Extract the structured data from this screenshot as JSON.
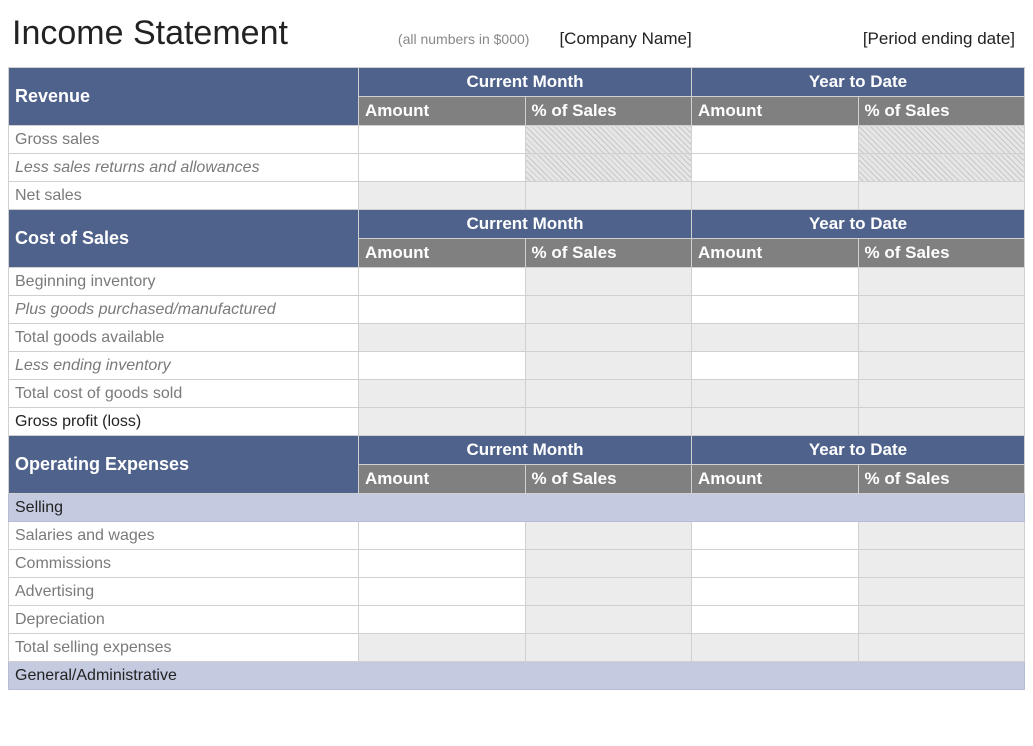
{
  "header": {
    "title": "Income Statement",
    "subtitle": "(all numbers in $000)",
    "company": "[Company Name]",
    "period": "[Period ending date]"
  },
  "columns": {
    "group1": "Current Month",
    "group2": "Year to Date",
    "sub1": "Amount",
    "sub2": "% of Sales"
  },
  "sections": {
    "revenue": {
      "title": "Revenue",
      "rows": {
        "gross_sales": "Gross sales",
        "less_returns": "Less sales returns and allowances",
        "net_sales": "Net sales"
      }
    },
    "cost_of_sales": {
      "title": "Cost of Sales",
      "rows": {
        "beg_inv": "Beginning inventory",
        "plus_goods": "Plus goods purchased/manufactured",
        "total_avail": "Total goods available",
        "less_end_inv": "Less ending inventory",
        "total_cogs": "Total cost of goods sold",
        "gross_profit": "Gross profit (loss)"
      }
    },
    "operating_expenses": {
      "title": "Operating Expenses",
      "subcat_selling": "Selling",
      "rows_selling": {
        "salaries": "Salaries and wages",
        "commissions": "Commissions",
        "advertising": "Advertising",
        "depreciation": "Depreciation",
        "total_selling": "Total selling expenses"
      },
      "subcat_general": "General/Administrative"
    }
  }
}
